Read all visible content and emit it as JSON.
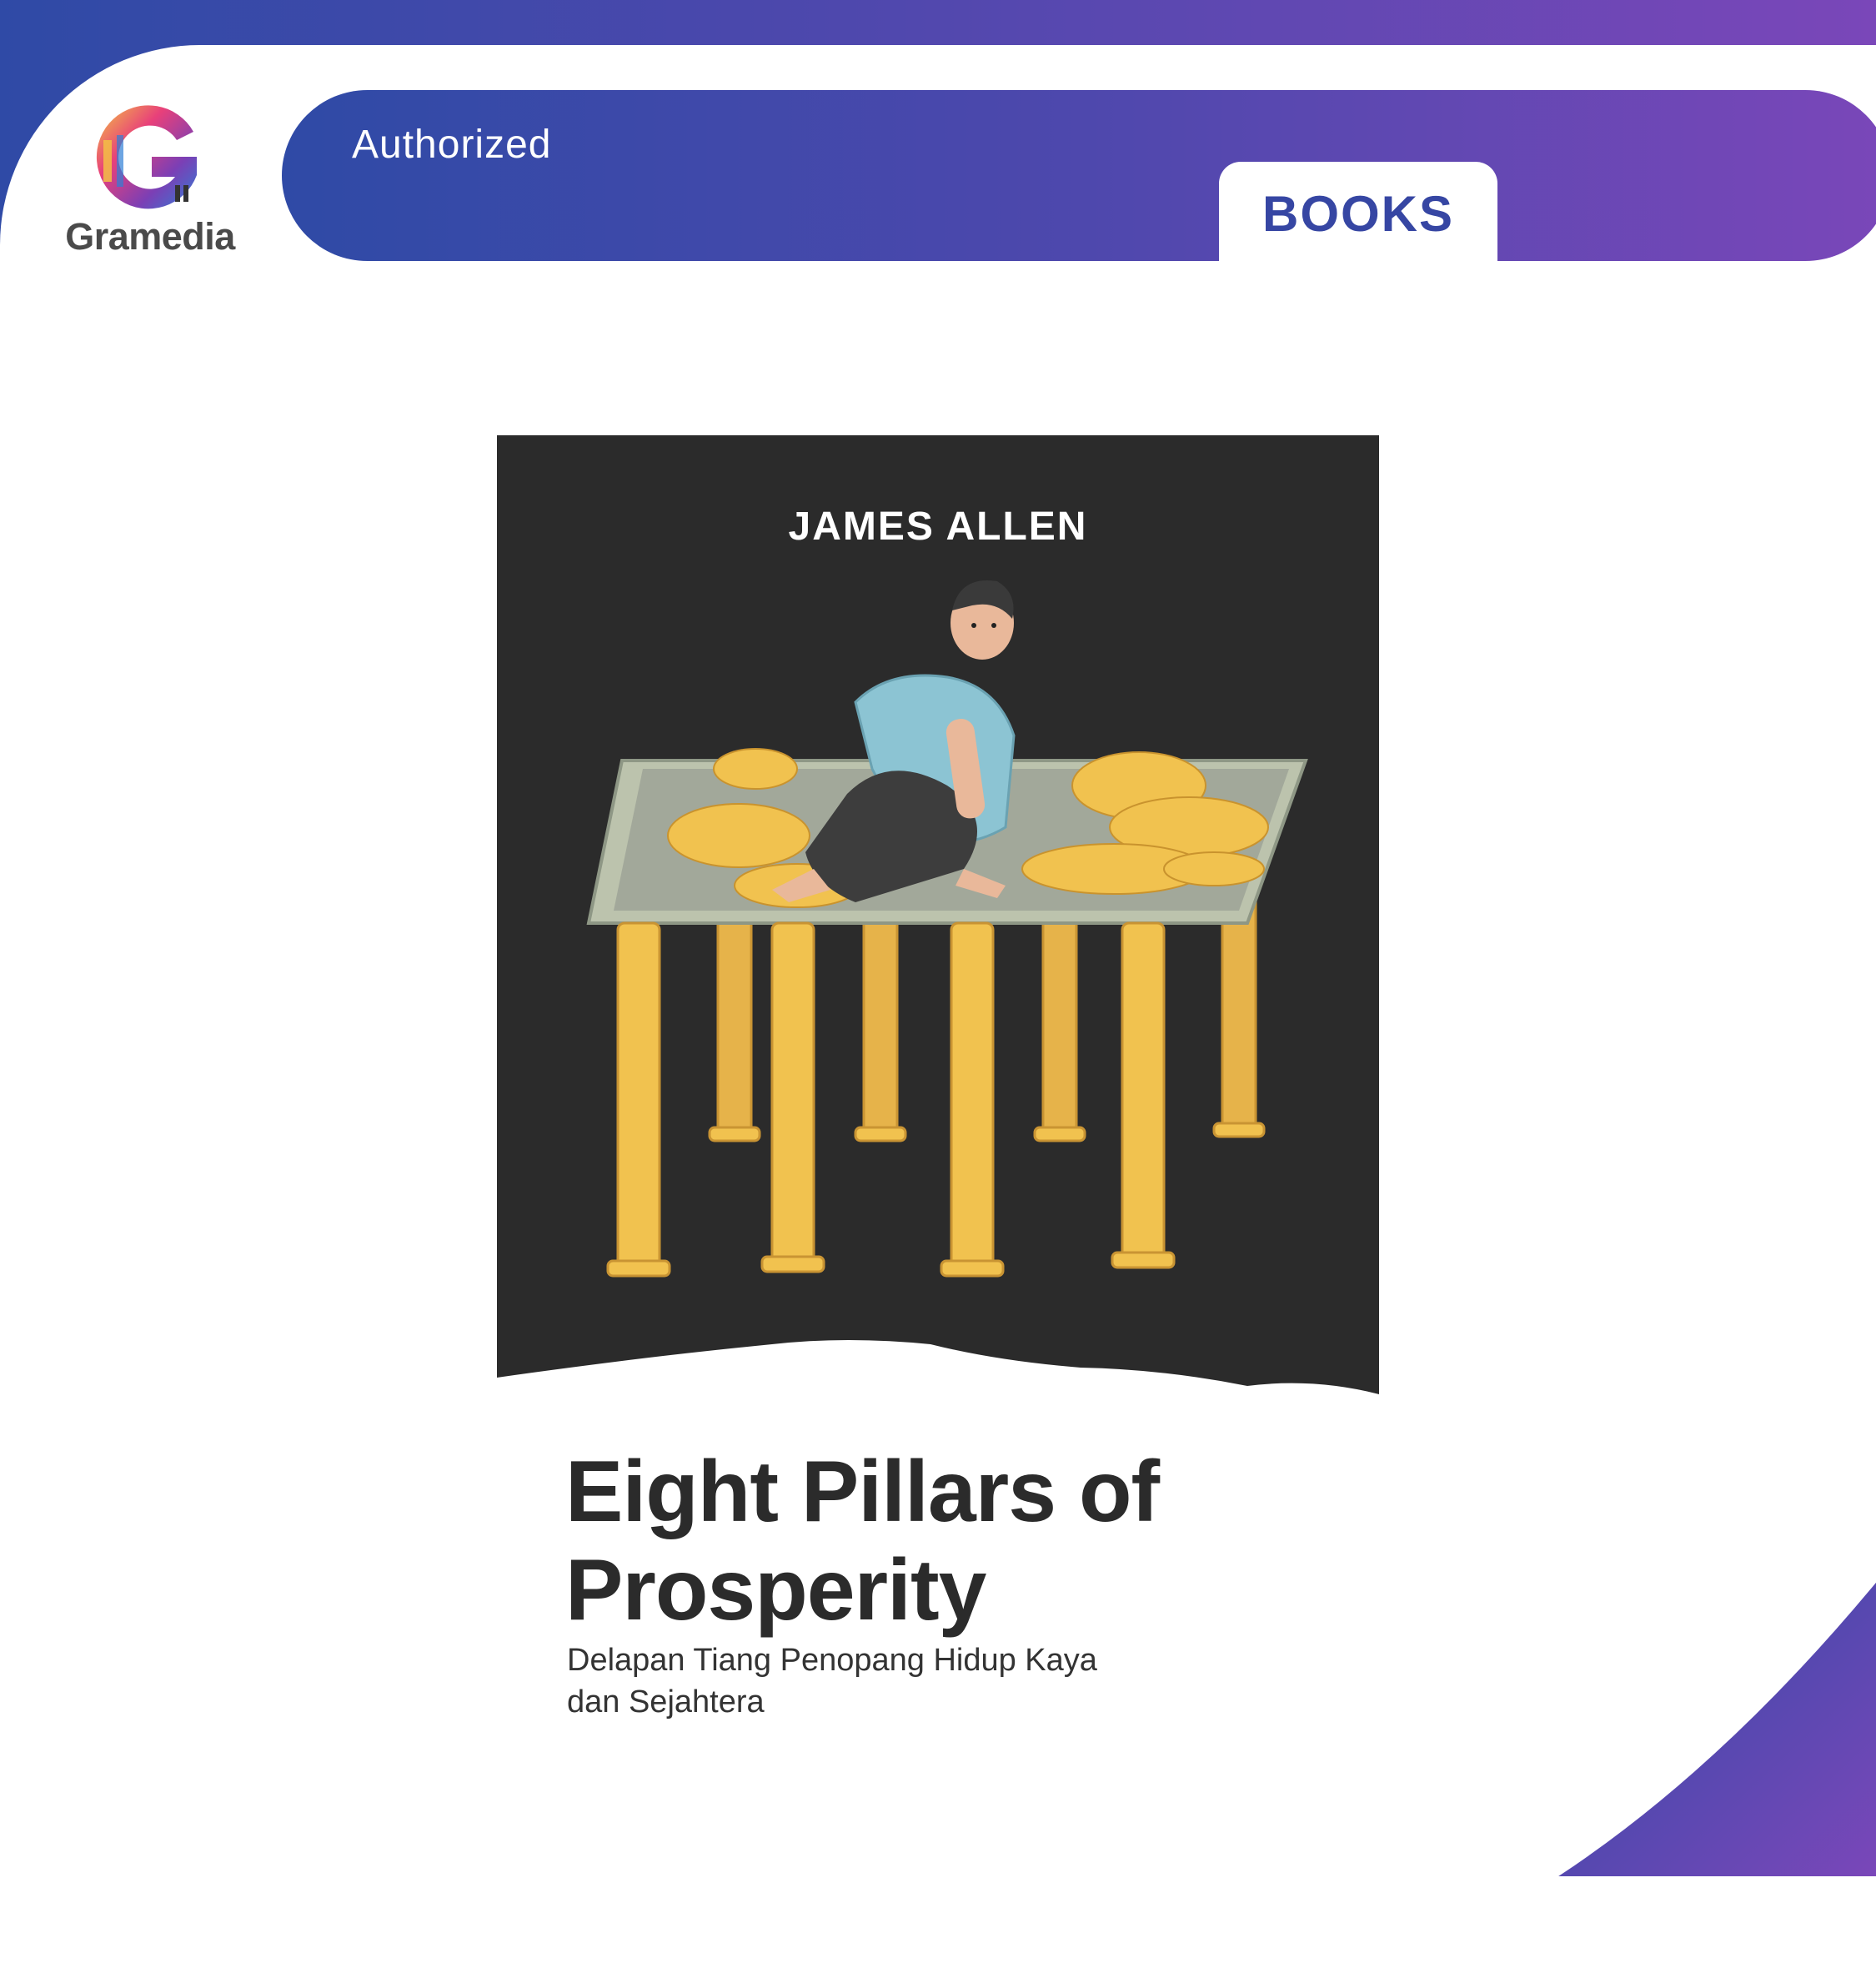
{
  "brand": {
    "logo_label": "Gramedia",
    "authorized_label": "Authorized",
    "category_label": "BOOKS",
    "colors": {
      "gradient_start": "#2f4aa6",
      "gradient_end": "#7a47b9",
      "tab_text": "#3646a3"
    }
  },
  "book": {
    "author": "JAMES ALLEN",
    "title": "Eight Pillars of Prosperity",
    "subtitle": "Delapan Tiang Penopang Hidup Kaya dan Sejahtera",
    "illustration": "man-sitting-on-table-of-gold-coins-supported-by-eight-pillars"
  }
}
